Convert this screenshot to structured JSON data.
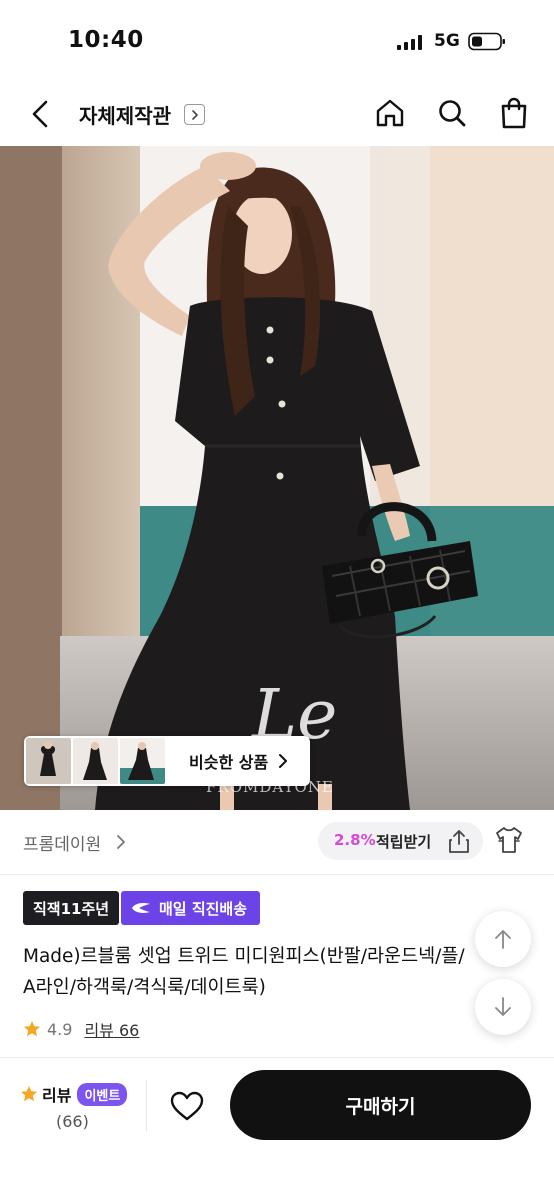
{
  "status_bar": {
    "time": "10:40",
    "network": "5G",
    "icons": [
      "signal-icon",
      "battery-icon"
    ]
  },
  "header": {
    "title": "자체제작관",
    "icons": [
      "back-arrow-icon",
      "chevron-right-icon",
      "home-icon",
      "search-icon",
      "shopping-bag-icon"
    ]
  },
  "hero": {
    "watermark_script": "Le",
    "watermark_text": "FROMDAYONE",
    "similar_label": "비슷한 상품",
    "thumbnail_count": 3
  },
  "brand": {
    "name": "프롬데이원",
    "points_percent": "2.8%",
    "points_label": "적립받기",
    "icons": [
      "share-icon",
      "tshirt-icon"
    ]
  },
  "badges": {
    "years": "직잭11주년",
    "shipping": "매일 직진배송"
  },
  "product": {
    "title": "Made)르블룸 셋업 트위드 미디원피스(반팔/라운드넥/플/\nA라인/하객룩/격식룩/데이트룩)",
    "rating": "4.9",
    "review_link": "리뷰 66"
  },
  "bottom_bar": {
    "review_label": "리뷰",
    "event_badge": "이벤트",
    "review_count": "(66)",
    "buy_label": "구매하기",
    "icons": [
      "star-icon",
      "heart-icon"
    ]
  },
  "scroll_controls": {
    "icons": [
      "arrow-up-icon",
      "arrow-down-icon"
    ]
  },
  "colors": {
    "brand_purple": "#6b43e6",
    "points_pink": "#d64ad6",
    "rating_star": "#f5a623",
    "dark": "#111111"
  }
}
